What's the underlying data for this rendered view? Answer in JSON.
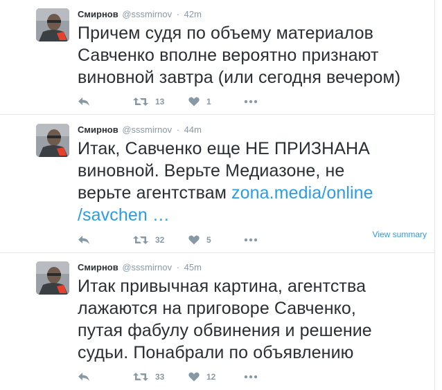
{
  "tweets": [
    {
      "fullname": "Смирнов",
      "username": "@sssmirnov",
      "separator": "·",
      "time": "42m",
      "text_line1": "Причем судя по объему материалов",
      "text_line2": "Савченко вполне вероятно признают",
      "text_line3": "виновной завтра (или сегодня вечером)",
      "retweets": "13",
      "likes": "1",
      "icons": [
        "reply-icon",
        "retweet-icon",
        "heart-icon",
        "more-icon"
      ]
    },
    {
      "fullname": "Смирнов",
      "username": "@sssmirnov",
      "separator": "·",
      "time": "44m",
      "text_line1": "Итак, Савченко еще НЕ ПРИЗНАНА",
      "text_line2": "виновной. Верьте Медиазоне, не",
      "text_line3": "верьте агентствам ",
      "link_part1": "zona.media/online",
      "link_part2": "/savchen …",
      "view_summary": "View summary",
      "retweets": "32",
      "likes": "5",
      "icons": [
        "reply-icon",
        "retweet-icon",
        "heart-icon",
        "more-icon"
      ]
    },
    {
      "fullname": "Смирнов",
      "username": "@sssmirnov",
      "separator": "·",
      "time": "45m",
      "text_line1": "Итак привычная картина, агентства",
      "text_line2": "лажаются на приговоре Савченко,",
      "text_line3": "путая фабулу обвинения и решение",
      "text_line4": "судьи. Понабрали по объявлению",
      "retweets": "33",
      "likes": "12",
      "icons": [
        "reply-icon",
        "retweet-icon",
        "heart-icon",
        "more-icon"
      ]
    }
  ],
  "colors": {
    "text": "#292f33",
    "muted": "#8899a6",
    "link": "#2b9ce6",
    "border": "#e1e8ed"
  }
}
